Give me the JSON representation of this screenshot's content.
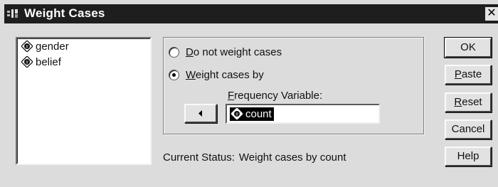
{
  "window": {
    "title": "Weight Cases",
    "close_glyph": "✕",
    "icon": "spss-app-icon"
  },
  "variables": [
    {
      "label": "gender",
      "icon": "numeric-variable-icon"
    },
    {
      "label": "belief",
      "icon": "numeric-variable-icon"
    }
  ],
  "options": {
    "no_weight": {
      "prefix": "",
      "mnemonic": "D",
      "rest": "o not weight cases",
      "selected": false
    },
    "weight_by": {
      "prefix": "",
      "mnemonic": "W",
      "rest": "eight cases by",
      "selected": true
    }
  },
  "frequency": {
    "label_mnemonic": "F",
    "label_rest": "requency Variable:",
    "value": "count",
    "icon": "numeric-variable-icon"
  },
  "transfer_button": {
    "icon": "arrow-left-icon"
  },
  "status": {
    "label": "Current Status:",
    "value": "Weight cases by count"
  },
  "buttons": {
    "ok": "OK",
    "paste_mnemonic": "P",
    "paste_rest": "aste",
    "reset_mnemonic": "R",
    "reset_rest": "eset",
    "cancel": "Cancel",
    "help": "Help"
  }
}
